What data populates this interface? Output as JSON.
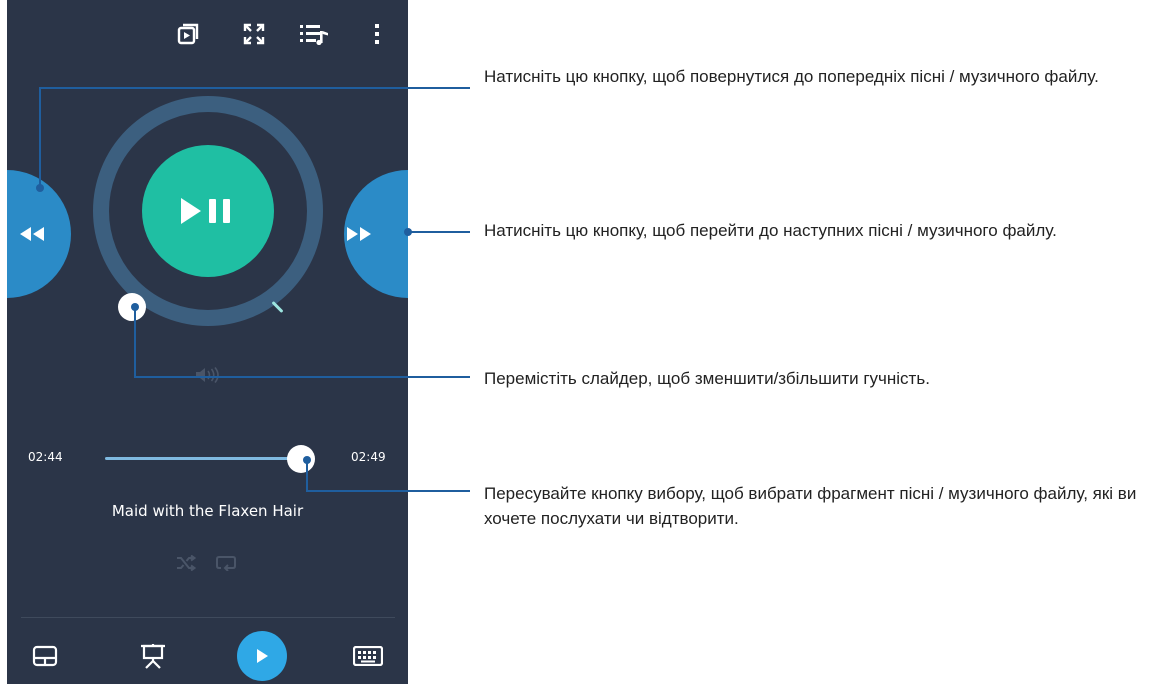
{
  "player": {
    "elapsed": "02:44",
    "total": "02:49",
    "song_title": "Maid with the Flaxen Hair",
    "seek_progress": 0.94,
    "accent_play": "#1fbfa3",
    "accent_side": "#2b8bc7",
    "background": "#2b3548"
  },
  "toolbar_icons": [
    "cast-icon",
    "fullscreen-icon",
    "playlist-icon",
    "more-vert-icon"
  ],
  "bottom_icons": [
    "touchpad-icon",
    "presentation-icon",
    "play-icon",
    "keyboard-icon"
  ],
  "annotations": {
    "prev": "Натисніть цю кнопку, щоб повернутися до попередніх пісні / музичного файлу.",
    "next": "Натисніть цю кнопку, щоб перейти до наступних пісні / музичного файлу.",
    "volume": "Перемістіть слайдер, щоб зменшити/збільшити гучність.",
    "seek": "Пересувайте кнопку вибору, щоб вибрати фрагмент пісні / музичного файлу, які ви хочете послухати чи відтворити."
  }
}
